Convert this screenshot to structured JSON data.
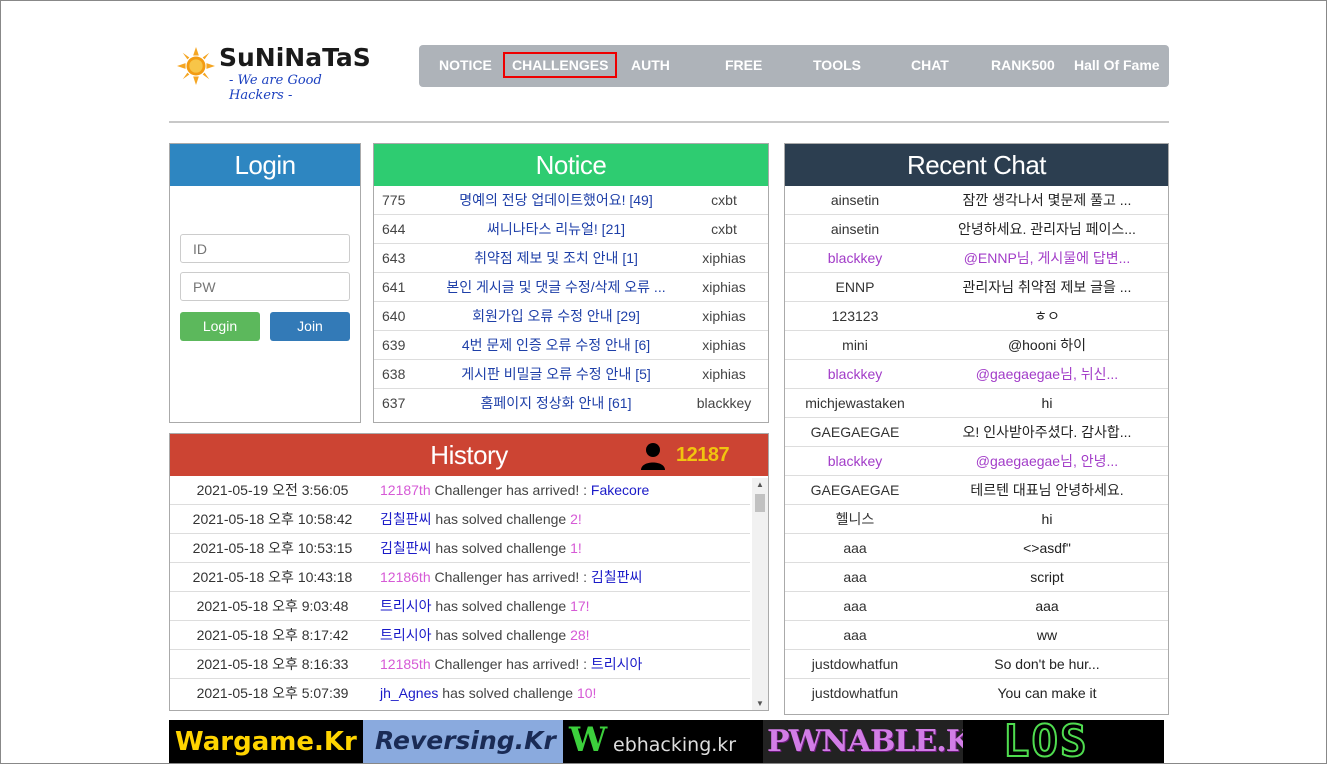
{
  "header": {
    "logo_title": "SuNiNaTaS",
    "logo_slogan": "- We are Good Hackers -",
    "nav": [
      {
        "label": "NOTICE"
      },
      {
        "label": "CHALLENGES"
      },
      {
        "label": "AUTH"
      },
      {
        "label": "FREE"
      },
      {
        "label": "TOOLS"
      },
      {
        "label": "CHAT"
      },
      {
        "label": "RANK500"
      },
      {
        "label": "Hall Of Fame"
      }
    ]
  },
  "login": {
    "title": "Login",
    "id_placeholder": "ID",
    "pw_placeholder": "PW",
    "login_label": "Login",
    "join_label": "Join"
  },
  "notice": {
    "title": "Notice",
    "rows": [
      {
        "num": "775",
        "title": "명예의 전당 업데이트했어요! [49]",
        "author": "cxbt"
      },
      {
        "num": "644",
        "title": "써니나타스 리뉴얼! [21]",
        "author": "cxbt"
      },
      {
        "num": "643",
        "title": "취약점 제보 및 조치 안내 [1]",
        "author": "xiphias"
      },
      {
        "num": "641",
        "title": "본인 게시글 및 댓글 수정/삭제 오류 ...",
        "author": "xiphias"
      },
      {
        "num": "640",
        "title": "회원가입 오류 수정 안내 [29]",
        "author": "xiphias"
      },
      {
        "num": "639",
        "title": "4번 문제 인증 오류 수정 안내 [6]",
        "author": "xiphias"
      },
      {
        "num": "638",
        "title": "게시판 비밀글 오류 수정 안내 [5]",
        "author": "xiphias"
      },
      {
        "num": "637",
        "title": "홈페이지 정상화 안내 [61]",
        "author": "blackkey"
      }
    ]
  },
  "history": {
    "title": "History",
    "count": "12187",
    "rows": [
      {
        "dt": "2021-05-19 오전 3:56:05",
        "a": "12187th",
        "b": " Challenger has arrived! : ",
        "c": "Fakecore",
        "d": ""
      },
      {
        "dt": "2021-05-18 오후 10:58:42",
        "a": "김칠판씨",
        "b": " has solved challenge ",
        "c": "2",
        "d": "!"
      },
      {
        "dt": "2021-05-18 오후 10:53:15",
        "a": "김칠판씨",
        "b": " has solved challenge ",
        "c": "1",
        "d": "!"
      },
      {
        "dt": "2021-05-18 오후 10:43:18",
        "a": "12186th",
        "b": " Challenger has arrived! : ",
        "c": "김칠판씨",
        "d": ""
      },
      {
        "dt": "2021-05-18 오후 9:03:48",
        "a": "트리시아",
        "b": " has solved challenge ",
        "c": "17",
        "d": "!"
      },
      {
        "dt": "2021-05-18 오후 8:17:42",
        "a": "트리시아",
        "b": " has solved challenge ",
        "c": "28",
        "d": "!"
      },
      {
        "dt": "2021-05-18 오후 8:16:33",
        "a": "12185th",
        "b": " Challenger has arrived! : ",
        "c": "트리시아",
        "d": ""
      },
      {
        "dt": "2021-05-18 오후 5:07:39",
        "a": "jh_Agnes",
        "b": " has solved challenge ",
        "c": "10",
        "d": "!"
      }
    ]
  },
  "chat": {
    "title": "Recent Chat",
    "rows": [
      {
        "who": "ainsetin",
        "text": "잠깐 생각나서 몇문제 풀고 ...",
        "style": "normal"
      },
      {
        "who": "ainsetin",
        "text": "안녕하세요. 관리자님 페이스...",
        "style": "normal"
      },
      {
        "who": "blackkey",
        "text": "@ENNP님, 게시물에 답변...",
        "style": "purple"
      },
      {
        "who": "ENNP",
        "text": "관리자님 취약점 제보 글을 ...",
        "style": "normal"
      },
      {
        "who": "123123",
        "text": "ㅎㅇ",
        "style": "normal"
      },
      {
        "who": "mini",
        "text": "@hooni 하이",
        "style": "normal"
      },
      {
        "who": "blackkey",
        "text": "@gaegaegae님, 뉘신...",
        "style": "purple"
      },
      {
        "who": "michjewastaken",
        "text": "hi",
        "style": "normal"
      },
      {
        "who": "GAEGAEGAE",
        "text": "오! 인사받아주셨다. 감사합...",
        "style": "normal"
      },
      {
        "who": "blackkey",
        "text": "@gaegaegae님, 안녕...",
        "style": "purple"
      },
      {
        "who": "GAEGAEGAE",
        "text": "테르텐 대표님 안녕하세요.",
        "style": "normal"
      },
      {
        "who": "헬니스",
        "text": "hi",
        "style": "normal"
      },
      {
        "who": "aaa",
        "text": "<>asdf\"",
        "style": "normal"
      },
      {
        "who": "aaa",
        "text": "script",
        "style": "normal"
      },
      {
        "who": "aaa",
        "text": "aaa",
        "style": "normal"
      },
      {
        "who": "aaa",
        "text": "ww",
        "style": "normal"
      },
      {
        "who": "justdowhatfun",
        "text": "So don't be hur...",
        "style": "normal"
      },
      {
        "who": "justdowhatfun",
        "text": "You can make it",
        "style": "normal"
      }
    ]
  },
  "banners": {
    "wargame": "Wargame.Kr",
    "reversing": "Reversing.Kr",
    "webhacking_w": "W",
    "webhacking_rest": "ebhacking.kr",
    "pwnable": "PWNABLE.KR",
    "los": "LOS"
  },
  "colors": {
    "login_head": "#2e86c1",
    "notice_head": "#2ecc71",
    "history_head": "#cc4433",
    "chat_head": "#2c3e50",
    "nav_bg": "#aeb3b9"
  }
}
